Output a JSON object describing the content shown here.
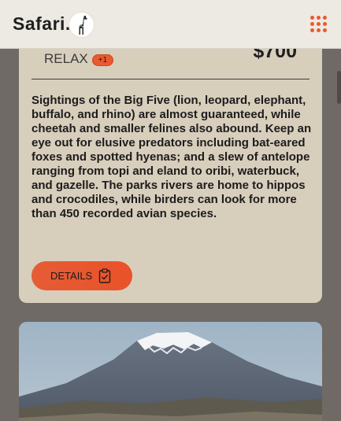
{
  "header": {
    "logo_text": "Safari.",
    "logo_icon": "giraffe-icon",
    "menu_icon": "grid-menu-icon"
  },
  "card": {
    "tag_label": "RELAX",
    "tag_badge": "+1",
    "price": "$700",
    "description": "Sightings of the Big Five (lion, leopard, elephant, buffalo, and rhino) are almost guaranteed, while cheetah and smaller felines also abound. Keep an eye out for elusive predators including bat-eared foxes and spotted hyenas; and a slew of antelope ranging from topi and eland to oribi, waterbuck, and gazelle. The parks rivers are home to hippos and crocodiles, while birders can look for more than 450 recorded avian species.",
    "details_label": "DETAILS",
    "details_icon": "clipboard-check-icon"
  },
  "colors": {
    "accent": "#ea5a2e",
    "card_bg": "#d8cebc",
    "header_bg": "#ede9e3",
    "page_bg": "#6f6a66"
  }
}
